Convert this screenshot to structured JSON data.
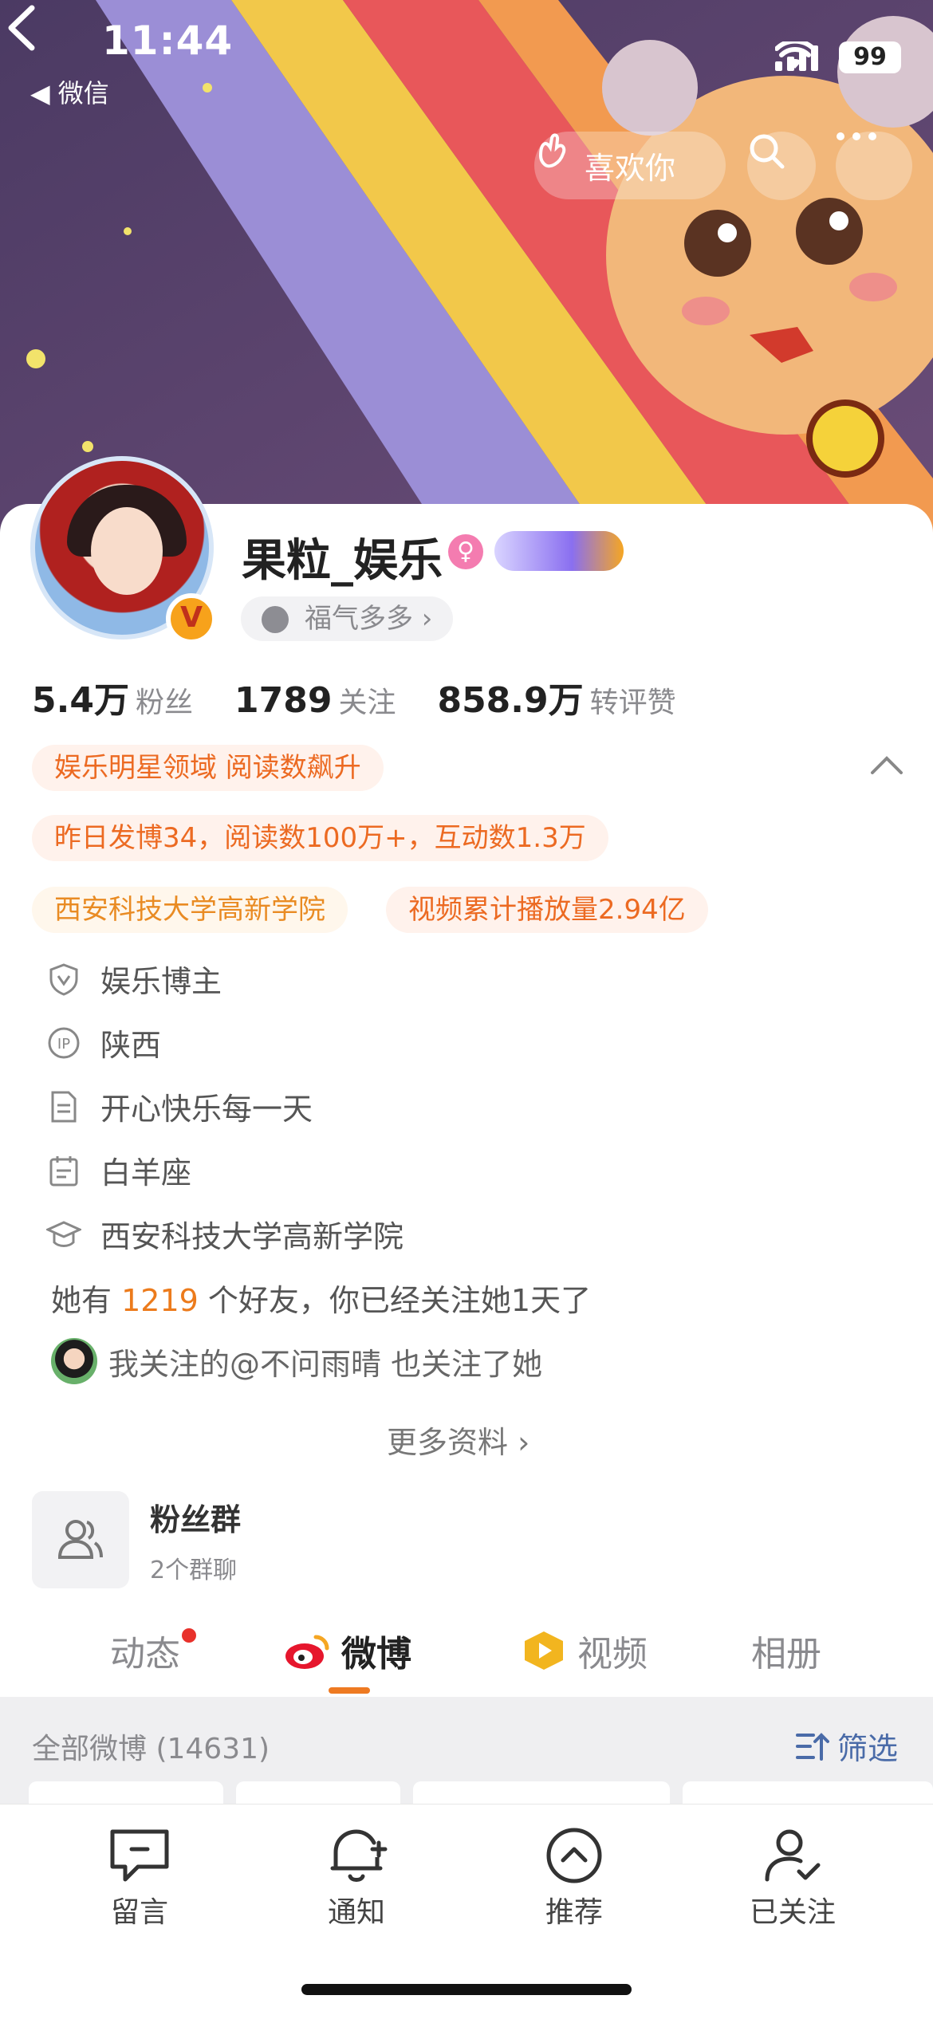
{
  "status_bar": {
    "time": "11:44",
    "back_app": "◀ 微信",
    "battery": "99"
  },
  "header": {
    "like_label": "喜欢你"
  },
  "profile": {
    "name": "果粒_娱乐",
    "gender_symbol": "♀",
    "fortune_label": "福气多多 ›",
    "verified_symbol": "V"
  },
  "stats": [
    {
      "value": "5.4万",
      "label": "粉丝"
    },
    {
      "value": "1789",
      "label": "关注"
    },
    {
      "value": "858.9万",
      "label": "转评赞"
    }
  ],
  "tags": {
    "domain": "娱乐明星领域 阅读数飙升",
    "yesterday": "昨日发博34，阅读数100万+，互动数1.3万",
    "school": "西安科技大学高新学院",
    "video": "视频累计播放量2.94亿"
  },
  "info_rows": [
    {
      "icon": "shield-v-icon",
      "text": "娱乐博主"
    },
    {
      "icon": "ip-icon",
      "text": "陕西"
    },
    {
      "icon": "document-icon",
      "text": "开心快乐每一天"
    },
    {
      "icon": "calendar-icon",
      "text": "白羊座"
    },
    {
      "icon": "graduation-cap-icon",
      "text": "西安科技大学高新学院"
    }
  ],
  "friends": {
    "prefix": "她有 ",
    "count": "1219",
    "suffix": " 个好友，你已经关注她1天了"
  },
  "mutual": "我关注的@不问雨晴 也关注了她",
  "more_info": "更多资料 ›",
  "fan_group": {
    "title": "粉丝群",
    "subtitle": "2个群聊"
  },
  "tabs": [
    "动态",
    "微博",
    "视频",
    "相册"
  ],
  "filter": {
    "title": "全部微博 (14631)",
    "button": "筛选"
  },
  "bottom_bar": [
    "留言",
    "通知",
    "推荐",
    "已关注"
  ],
  "colors": {
    "accent": "#ee7a22",
    "tag_orange": "#ec6a22",
    "link_blue": "#4a6ba8"
  }
}
